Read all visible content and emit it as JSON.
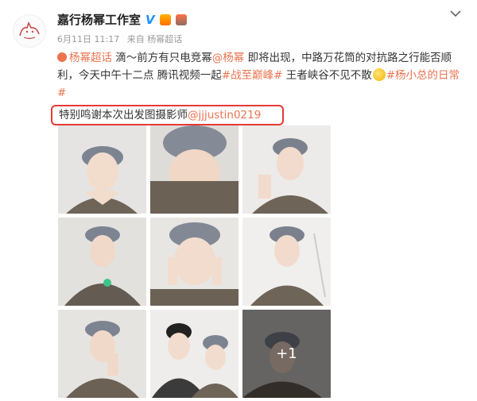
{
  "post": {
    "author": "嘉行杨幂工作室",
    "verified_badge": "V",
    "date": "6月11日 11:17",
    "source": "来自 杨幂超话",
    "menu_icon": "chevron-down-icon",
    "text": {
      "p1": "杨幂超话",
      "p2": " 滴～前方有只电竞幂",
      "p3": "@杨幂",
      "p4": " 即将出现，中路万花筒的对抗路之行能否顺利，今天中午十二点 腾讯视频一起",
      "p5": "#战至巅峰#",
      "p6": " 王者峡谷不见不散",
      "p7": "#杨小总的日常#"
    },
    "thanks": {
      "text": "特别鸣谢本次出发图摄影师",
      "mention": "@jjjustin0219"
    },
    "photos": {
      "more_label": "+1",
      "count": 9
    }
  },
  "colors": {
    "link": "#eb7350",
    "highlight_border": "#e53935",
    "verified": "#1e90ff"
  }
}
